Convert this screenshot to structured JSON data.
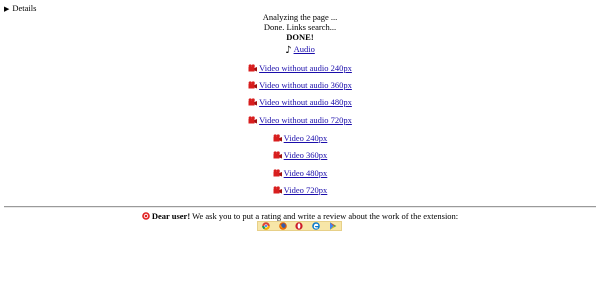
{
  "details": {
    "label": "Details",
    "toggle_glyph": "▶"
  },
  "status": {
    "line1": "Analyzing the page ...",
    "line2": "Done. Links search...",
    "line3": "DONE!"
  },
  "links": [
    {
      "icon": "music-note-icon",
      "label": "Audio"
    },
    {
      "icon": "video-camera-icon",
      "label": "Video without audio 240px"
    },
    {
      "icon": "video-camera-icon",
      "label": "Video without audio 360px"
    },
    {
      "icon": "video-camera-icon",
      "label": "Video without audio 480px"
    },
    {
      "icon": "video-camera-icon",
      "label": "Video without audio 720px"
    },
    {
      "icon": "video-camera-icon",
      "label": "Video 240px"
    },
    {
      "icon": "video-camera-icon",
      "label": "Video 360px"
    },
    {
      "icon": "video-camera-icon",
      "label": "Video 480px"
    },
    {
      "icon": "video-camera-icon",
      "label": "Video 720px"
    }
  ],
  "review": {
    "greeting": "Dear user!",
    "message": " We ask you to put a rating and write a review about the work of the extension:",
    "icon": "warning-circle-icon"
  },
  "browsers": [
    {
      "icon": "chrome-icon",
      "name": "Chrome"
    },
    {
      "icon": "firefox-icon",
      "name": "Firefox"
    },
    {
      "icon": "opera-icon",
      "name": "Opera"
    },
    {
      "icon": "edge-icon",
      "name": "Edge"
    },
    {
      "icon": "google-play-icon",
      "name": "Google Play"
    }
  ],
  "colors": {
    "link": "#1a0dab",
    "camera": "#d81e1e",
    "warning": "#e02020",
    "browser_bar": "#f7e6a8"
  }
}
